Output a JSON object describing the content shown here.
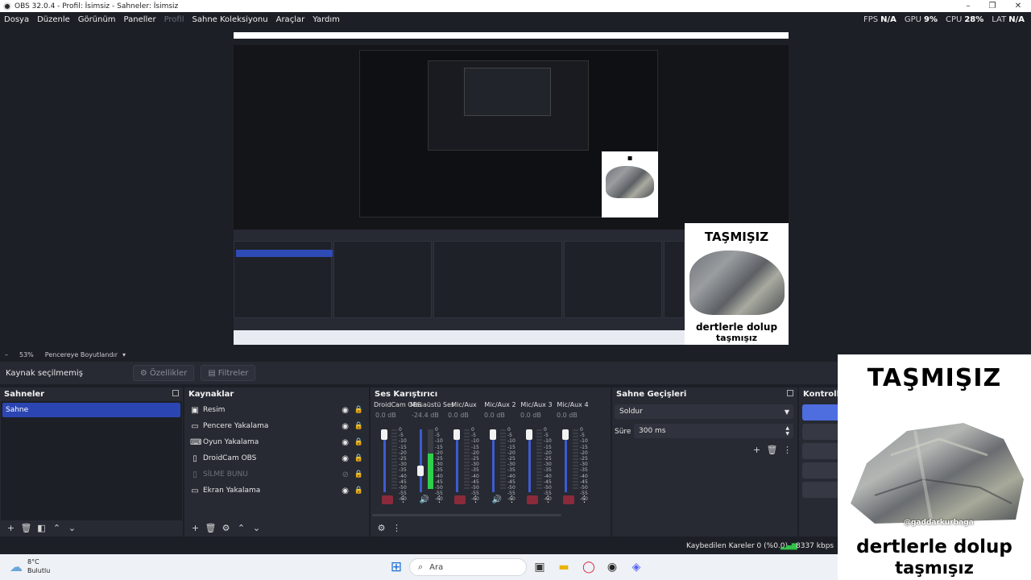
{
  "window": {
    "title": "OBS 32.0.4 - Profil: İsimsiz - Sahneler: İsimsiz",
    "controls": [
      "–",
      "❐",
      "✕"
    ]
  },
  "menu": {
    "items": [
      "Dosya",
      "Düzenle",
      "Görünüm",
      "Paneller",
      "Profil",
      "Sahne Koleksiyonu",
      "Araçlar",
      "Yardım"
    ],
    "disabled_index": 4
  },
  "stats": {
    "fps_label": "FPS",
    "fps_value": "N/A",
    "gpu_label": "GPU",
    "gpu_value": "9%",
    "cpu_label": "CPU",
    "cpu_value": "28%",
    "lat_label": "LAT",
    "lat_value": "N/A"
  },
  "preview_controls": {
    "zoom_out": "–",
    "zoom": "53%",
    "fit": "Pencereye Boyutlandır",
    "dropdown": "▾"
  },
  "source_toolbar": {
    "label": "Kaynak seçilmemiş",
    "properties": "Özellikler",
    "filters": "Filtreler"
  },
  "scenes": {
    "title": "Sahneler",
    "items": [
      "Sahne"
    ]
  },
  "sources": {
    "title": "Kaynaklar",
    "items": [
      {
        "name": "Resim",
        "icon": "image-icon",
        "glyph": "▣",
        "visible": true
      },
      {
        "name": "Pencere Yakalama",
        "icon": "window-icon",
        "glyph": "▭",
        "visible": true
      },
      {
        "name": "Oyun Yakalama",
        "icon": "gamepad-icon",
        "glyph": "⌨",
        "visible": true
      },
      {
        "name": "DroidCam OBS",
        "icon": "file-icon",
        "glyph": "▯",
        "visible": true
      },
      {
        "name": "SİLME BUNU",
        "icon": "file-icon",
        "glyph": "▯",
        "visible": false
      },
      {
        "name": "Ekran Yakalama",
        "icon": "monitor-icon",
        "glyph": "▭",
        "visible": true
      }
    ]
  },
  "mixer": {
    "title": "Ses Karıştırıcı",
    "scale": [
      "0",
      "-5",
      "-10",
      "-15",
      "-20",
      "-25",
      "-30",
      "-35",
      "-40",
      "-45",
      "-50",
      "-55",
      "-60"
    ],
    "channels": [
      {
        "name": "DroidCam OBS",
        "db": "0.0 dB",
        "level": 1.0,
        "muted": true,
        "meter": 0.0
      },
      {
        "name": "Masaüstü Ses",
        "db": "-24.4 dB",
        "level": 0.3,
        "muted": false,
        "meter": 0.6
      },
      {
        "name": "Mic/Aux",
        "db": "0.0 dB",
        "level": 1.0,
        "muted": true,
        "meter": 0.0
      },
      {
        "name": "Mic/Aux 2",
        "db": "0.0 dB",
        "level": 1.0,
        "muted": false,
        "meter": 0.0
      },
      {
        "name": "Mic/Aux 3",
        "db": "0.0 dB",
        "level": 1.0,
        "muted": true,
        "meter": 0.0
      },
      {
        "name": "Mic/Aux 4",
        "db": "0.0 dB",
        "level": 1.0,
        "muted": true,
        "meter": 0.0
      }
    ]
  },
  "transitions": {
    "title": "Sahne Geçişleri",
    "selected": "Soldur",
    "duration_label": "Süre",
    "duration_value": "300 ms"
  },
  "controls": {
    "title": "Kontroller"
  },
  "status": {
    "dropped": "Kaybedilen Kareler 0 (%0.0)",
    "bitrate": "8337 kbps"
  },
  "taskbar": {
    "temperature": "8°C",
    "condition": "Bulutlu",
    "search_placeholder": "Ara"
  },
  "overlay": {
    "top_text": "TAŞMIŞIZ",
    "watermark": "@gaddarkurbaga",
    "bottom_line1": "dertlerle dolup",
    "bottom_line2": "taşmışız"
  },
  "colors": {
    "accent": "#2b46b3",
    "background": "#1d1f26",
    "panel": "#272a33",
    "primary_button": "#4e6ee0",
    "mute_red": "#8a2a3a",
    "meter_green": "#2fd04a"
  }
}
